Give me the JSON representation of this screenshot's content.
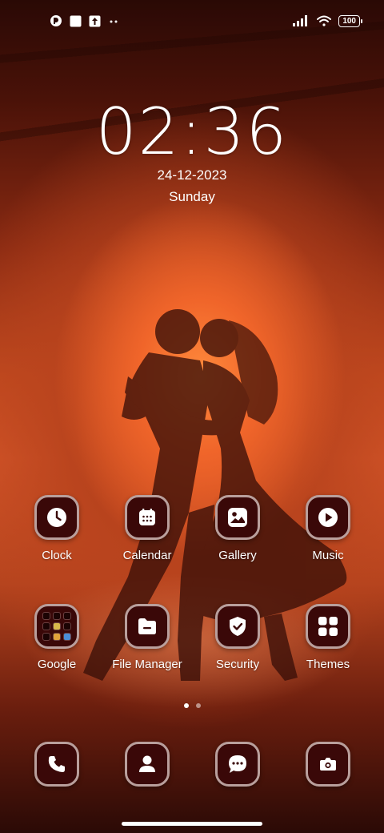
{
  "status_bar": {
    "battery": "100",
    "left_icons": [
      "app-badge-icon",
      "notification-square-icon",
      "upload-icon",
      "more-dots-icon"
    ],
    "right_icons": [
      "signal-icon",
      "wifi-icon",
      "battery-icon"
    ]
  },
  "clock_widget": {
    "time": "02:36",
    "date": "24-12-2023",
    "day": "Sunday"
  },
  "apps_row1": [
    {
      "label": "Clock",
      "icon": "clock-icon"
    },
    {
      "label": "Calendar",
      "icon": "calendar-icon"
    },
    {
      "label": "Gallery",
      "icon": "gallery-icon"
    },
    {
      "label": "Music",
      "icon": "play-icon"
    }
  ],
  "apps_row2": [
    {
      "label": "Google",
      "icon": "google-folder-icon"
    },
    {
      "label": "File Manager",
      "icon": "folder-icon"
    },
    {
      "label": "Security",
      "icon": "shield-icon"
    },
    {
      "label": "Themes",
      "icon": "themes-grid-icon"
    }
  ],
  "dock": [
    {
      "icon": "phone-icon"
    },
    {
      "icon": "contacts-icon"
    },
    {
      "icon": "messages-icon"
    },
    {
      "icon": "camera-icon"
    }
  ],
  "page_indicator": {
    "pages": 2,
    "active": 1
  },
  "colors": {
    "icon_bg": "#3a0808",
    "icon_border": "#b99f9c",
    "wallpaper_accent": "#e8602a"
  }
}
